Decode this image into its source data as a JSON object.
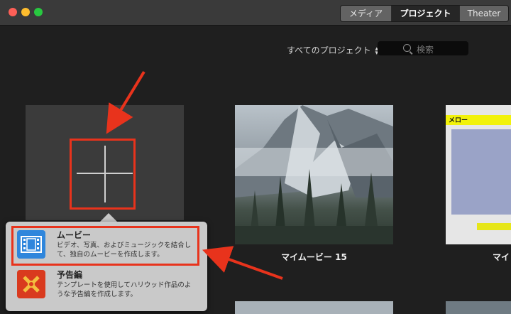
{
  "titlebar": {
    "tabs": [
      {
        "label": "メディア",
        "active": false
      },
      {
        "label": "プロジェクト",
        "active": true
      },
      {
        "label": "Theater",
        "active": false
      }
    ]
  },
  "toolbar": {
    "filter_label": "すべてのプロジェクト",
    "search_placeholder": "検索"
  },
  "projects": [
    {
      "title": "マイムービー 15"
    },
    {
      "title": "マイ"
    }
  ],
  "partial_project_label": "メロー",
  "new_project_popover": {
    "options": [
      {
        "title": "ムービー",
        "description": "ビデオ、写真、およびミュージックを結合して、独自のムービーを作成します。",
        "icon": "film-strip-icon"
      },
      {
        "title": "予告編",
        "description": "テンプレートを使用してハリウッド作品のような予告編を作成します。",
        "icon": "clapper-trailer-icon"
      }
    ]
  },
  "colors": {
    "accent_annotation": "#e8331c",
    "background": "#1f1f1f",
    "titlebar": "#3a3a3a"
  }
}
